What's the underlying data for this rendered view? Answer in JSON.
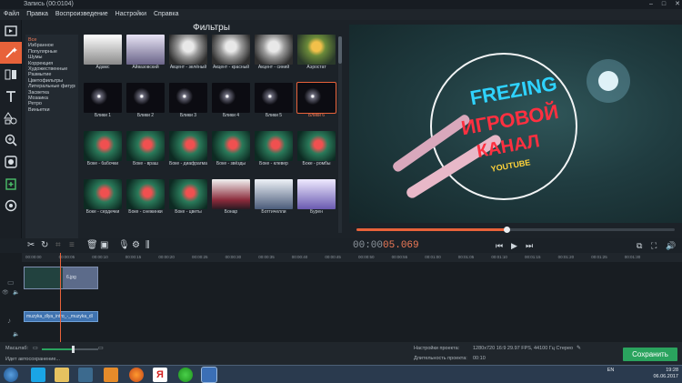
{
  "window": {
    "title": "Запись (00:0104)"
  },
  "menu": [
    "Файл",
    "Правка",
    "Воспроизведение",
    "Настройки",
    "Справка"
  ],
  "filters_title": "Фильтры",
  "categories": [
    {
      "label": "Все",
      "selected": true
    },
    {
      "label": "Избранное"
    },
    {
      "label": "Популярные"
    },
    {
      "label": "Шумы"
    },
    {
      "label": "Коррекция"
    },
    {
      "label": "Художественные"
    },
    {
      "label": "Размытие"
    },
    {
      "label": "Цветофильтры"
    },
    {
      "label": "Литеральные фигуры"
    },
    {
      "label": "Засветка"
    },
    {
      "label": "Мозаика"
    },
    {
      "label": "Ретро"
    },
    {
      "label": "Виньетки"
    }
  ],
  "filters": [
    {
      "label": "Адамс",
      "kind": "grad-white"
    },
    {
      "label": "Айвазовский",
      "kind": "grad-lilac"
    },
    {
      "label": "Акцент - зелёный",
      "kind": "figure"
    },
    {
      "label": "Акцент - красный",
      "kind": "figure"
    },
    {
      "label": "Акцент - синий",
      "kind": "figure"
    },
    {
      "label": "Аэростат",
      "kind": "balloon"
    },
    {
      "label": "Блики 1",
      "kind": "sparkle"
    },
    {
      "label": "Блики 2",
      "kind": "sparkle"
    },
    {
      "label": "Блики 3",
      "kind": "sparkle"
    },
    {
      "label": "Блики 4",
      "kind": "sparkle"
    },
    {
      "label": "Блики 5",
      "kind": "sparkle"
    },
    {
      "label": "Блики 6",
      "kind": "sparkle",
      "selected": true
    },
    {
      "label": "Боке - бабочки",
      "kind": "bokeh"
    },
    {
      "label": "Боке - враш",
      "kind": "bokeh"
    },
    {
      "label": "Боке - диафрагма",
      "kind": "bokeh"
    },
    {
      "label": "Боке - звёзды",
      "kind": "bokeh"
    },
    {
      "label": "Боке - клевер",
      "kind": "bokeh"
    },
    {
      "label": "Боке - ромбы",
      "kind": "bokeh"
    },
    {
      "label": "Боке - сердечки",
      "kind": "bokeh"
    },
    {
      "label": "Боке - снежинки",
      "kind": "bokeh"
    },
    {
      "label": "Боке - цветы",
      "kind": "bokeh"
    },
    {
      "label": "Бонар",
      "kind": "grad-red"
    },
    {
      "label": "Боттичелли",
      "kind": "grad-blue"
    },
    {
      "label": "Бурен",
      "kind": "grad-violet"
    }
  ],
  "preview": {
    "line1": "FREZING",
    "line2": "ИГРОВОЙ",
    "line3": "КАНАЛ",
    "line4": "YOUTUBE"
  },
  "playback": {
    "timecode_elapsed": "00:00",
    "timecode_current": "05.069",
    "progress": 0.47
  },
  "ruler_ticks": [
    "00:00:00",
    "00:00:05",
    "00:00:10",
    "00:00:15",
    "00:00:20",
    "00:00:25",
    "00:00:30",
    "00:00:35",
    "00:00:40",
    "00:00:45",
    "00:00:50",
    "00:00:55",
    "00:01:00",
    "00:01:05",
    "00:01:10",
    "00:01:15",
    "00:01:20",
    "00:01:25",
    "00:01:30"
  ],
  "timeline": {
    "video_clip_name": "6.jpg",
    "audio_clip_name": "muzyka_dlya_intro_-_muzyka_dl"
  },
  "status": {
    "zoom_label": "Масштаб:",
    "autosave": "Идет автосохранение...",
    "project_settings_label": "Настройки проекта:",
    "project_settings_value": "1280x720 16:9 29.97 FPS, 44100 Гц Стерео",
    "duration_label": "Длительность проекта:",
    "duration_value": "00:10",
    "save_button": "Сохранить"
  },
  "tray": {
    "lang": "EN",
    "time": "19:28",
    "date": "06.06.2017"
  },
  "colors": {
    "accent": "#e8623a",
    "save": "#2aa35e",
    "neon": "#2fd3ff",
    "neon_red": "#ff3040"
  }
}
